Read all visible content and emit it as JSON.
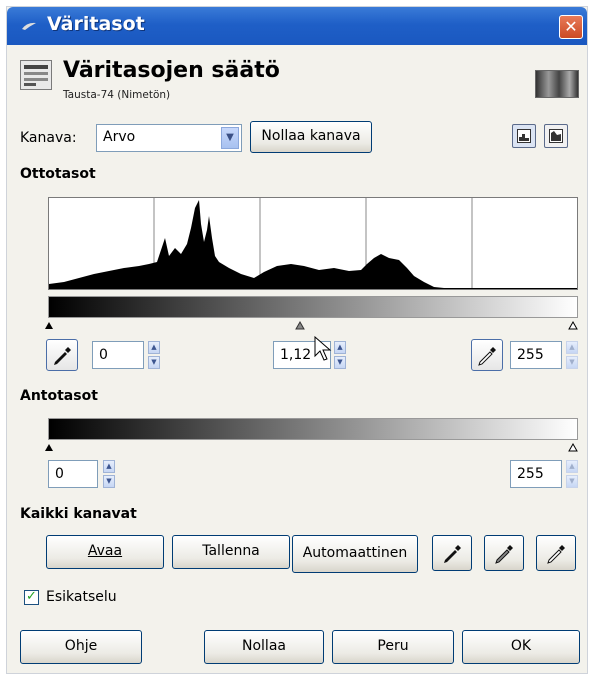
{
  "window": {
    "title": "Väritasot",
    "close_label": "✕"
  },
  "header": {
    "title": "Väritasojen säätö",
    "subtitle": "Tausta-74 (Nimetön)"
  },
  "channel": {
    "label": "Kanava:",
    "value": "Arvo",
    "reset_button": "Nollaa kanava"
  },
  "input_levels": {
    "heading": "Ottotasot",
    "black_point": "0",
    "gamma": "1,12",
    "white_point": "255"
  },
  "output_levels": {
    "heading": "Antotasot",
    "low": "0",
    "high": "255"
  },
  "all_channels": {
    "heading": "Kaikki kanavat",
    "open_button": "Avaa",
    "save_button": "Tallenna",
    "auto_button": "Automaattinen"
  },
  "preview": {
    "label": "Esikatselu",
    "checked": true
  },
  "footer": {
    "help_button": "Ohje",
    "reset_button": "Nollaa",
    "cancel_button": "Peru",
    "ok_button": "OK"
  },
  "icons": [
    "levels-icon",
    "image-thumbnail",
    "linear-histogram-icon",
    "log-histogram-icon",
    "black-eyedropper-icon",
    "gray-eyedropper-icon",
    "white-eyedropper-icon",
    "mouse-cursor-icon",
    "check-icon"
  ],
  "colors": {
    "titlebar": "#1f5fc7",
    "close": "#cc4a24",
    "dialog_bg": "#f3f2ec",
    "button_border": "#003c74"
  }
}
